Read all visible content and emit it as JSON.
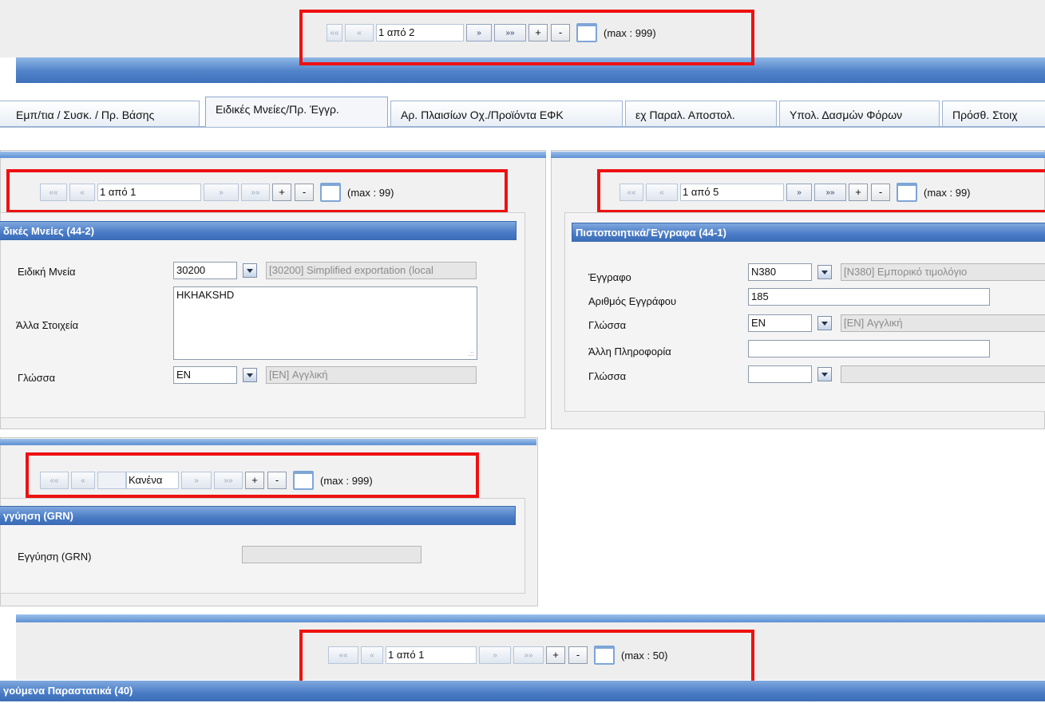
{
  "pagers": {
    "top": {
      "text": "1 από 2",
      "max": "(max : 999)",
      "first": "««",
      "prev": "«",
      "next": "»",
      "last": "»»",
      "plus": "+",
      "minus": "-"
    },
    "left": {
      "text": "1 από 1",
      "max": "(max : 99)",
      "first": "««",
      "prev": "«",
      "next": "»",
      "last": "»»",
      "plus": "+",
      "minus": "-"
    },
    "right": {
      "text": "1 από 5",
      "max": "(max : 99)",
      "first": "««",
      "prev": "«",
      "next": "»",
      "last": "»»",
      "plus": "+",
      "minus": "-"
    },
    "guarantee": {
      "text": "Κανένα",
      "max": "(max : 999)",
      "first": "««",
      "prev": "«",
      "next": "»",
      "last": "»»",
      "plus": "+",
      "minus": "-"
    },
    "bottom": {
      "text": "1 από 1",
      "max": "(max : 50)",
      "first": "««",
      "prev": "«",
      "next": "»",
      "last": "»»",
      "plus": "+",
      "minus": "-"
    }
  },
  "tabs": [
    "Εμπ/τια / Συσκ. / Πρ. Βάσης",
    "Ειδικές Μνείες/Πρ. Έγγρ.",
    "Αρ. Πλαισίων Οχ./Προϊόντα ΕΦΚ",
    "εχ Παραλ. Αποστολ.",
    "Υπολ. Δασμών Φόρων",
    "Πρόσθ. Στοιχ"
  ],
  "special_mentions": {
    "header": "δικές Μνείες (44-2)",
    "mention_label": "Ειδική Μνεία",
    "mention_code": "30200",
    "mention_desc": "[30200] Simplified exportation (local",
    "other_label": "Άλλα Στοιχεία",
    "other_value": "HKHAKSHD",
    "lang_label": "Γλώσσα",
    "lang_code": "EN",
    "lang_desc": "[EN] Αγγλική"
  },
  "documents": {
    "header": "Πιστοποιητικά/Έγγραφα (44-1)",
    "doc_label": "Έγγραφο",
    "doc_code": "N380",
    "doc_desc": "[N380] Εμπορικό τιμολόγιο",
    "docnum_label": "Αριθμός Εγγράφου",
    "docnum_value": "185",
    "lang_label": "Γλώσσα",
    "lang_code": "EN",
    "lang_desc": "[EN] Αγγλική",
    "info_label": "Άλλη Πληροφορία",
    "info_value": "",
    "lang2_label": "Γλώσσα",
    "lang2_code": "",
    "lang2_desc": ""
  },
  "guarantee": {
    "header": "γγύηση (GRN)",
    "label": "Εγγύηση (GRN)",
    "value": ""
  },
  "bottom_section": {
    "header": "γούμενα Παραστατικά (40)"
  },
  "colors": {
    "highlight": "#ee1111",
    "header_blue": "#4a7cc6"
  }
}
